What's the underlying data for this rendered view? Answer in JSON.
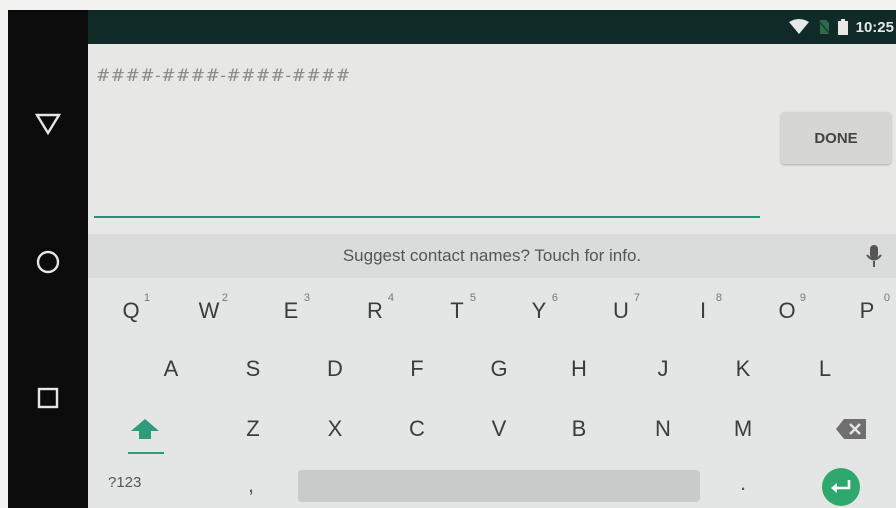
{
  "status_bar": {
    "time": "10:25",
    "icons": [
      "wifi-icon",
      "no-sim-icon",
      "battery-icon"
    ]
  },
  "nav_bar": {
    "buttons": [
      "back-triangle-icon",
      "home-circle-icon",
      "recents-square-icon"
    ]
  },
  "editor": {
    "masked_value": "####-####-####-####",
    "done_label": "DONE",
    "accent_color": "#2c8f7e"
  },
  "keyboard": {
    "suggestion_text": "Suggest contact names? Touch for info.",
    "row1": [
      {
        "label": "Q",
        "hint": "1"
      },
      {
        "label": "W",
        "hint": "2"
      },
      {
        "label": "E",
        "hint": "3"
      },
      {
        "label": "R",
        "hint": "4"
      },
      {
        "label": "T",
        "hint": "5"
      },
      {
        "label": "Y",
        "hint": "6"
      },
      {
        "label": "U",
        "hint": "7"
      },
      {
        "label": "I",
        "hint": "8"
      },
      {
        "label": "O",
        "hint": "9"
      },
      {
        "label": "P",
        "hint": "0"
      }
    ],
    "row2": [
      "A",
      "S",
      "D",
      "F",
      "G",
      "H",
      "J",
      "K",
      "L"
    ],
    "row3": [
      "Z",
      "X",
      "C",
      "V",
      "B",
      "N",
      "M"
    ],
    "symbols_label": "?123",
    "comma_label": ",",
    "period_label": ".",
    "enter_color": "#2ea86d"
  }
}
